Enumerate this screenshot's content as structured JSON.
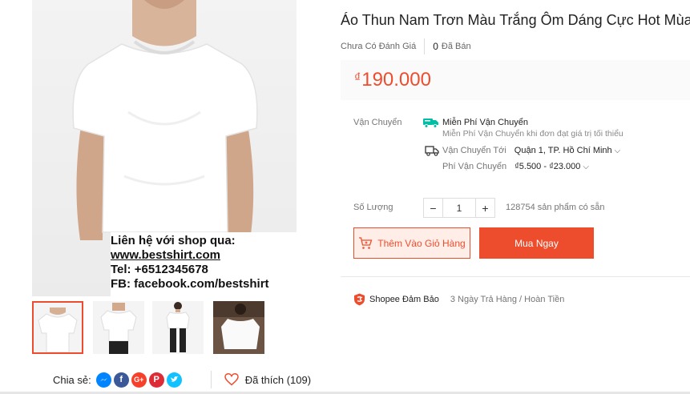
{
  "product": {
    "title": "Áo Thun Nam Trơn Màu Trắng Ôm Dáng Cực Hot Mùa Hè",
    "rating_text": "Chưa Có Đánh Giá",
    "sold_count": "0",
    "sold_label": "Đã Bán",
    "price_currency": "₫",
    "price": "190.000"
  },
  "image_overlay": {
    "line1": "Liên hệ với shop qua:",
    "line2": "www.bestshirt.com",
    "line3": "Tel: +6512345678",
    "line4": "FB: facebook.com/bestshirt"
  },
  "shipping": {
    "label": "Vận Chuyển",
    "free_title": "Miễn Phí Vận Chuyển",
    "free_desc": "Miễn Phí Vận Chuyển khi đơn đạt giá trị tối thiểu",
    "to_label": "Vận Chuyển Tới",
    "to_value": "Quận 1, TP. Hồ Chí Minh",
    "fee_label": "Phí Vận Chuyển",
    "fee_value": "₫5.500 - ₫23.000",
    "icons": [
      "free-shipping-truck-icon",
      "truck-icon"
    ]
  },
  "quantity": {
    "label": "Số Lượng",
    "minus": "−",
    "value": "1",
    "plus": "+",
    "stock": "128754 sản phẩm có sẵn"
  },
  "actions": {
    "add_to_cart": "Thêm Vào Giỏ Hàng",
    "buy_now": "Mua Ngay"
  },
  "guarantee": {
    "title": "Shopee Đảm Bảo",
    "desc": "3 Ngày Trả Hàng / Hoàn Tiền"
  },
  "share": {
    "label": "Chia sẻ:",
    "networks": [
      {
        "name": "messenger-icon",
        "color": "#0084ff"
      },
      {
        "name": "facebook-icon",
        "color": "#3b5999"
      },
      {
        "name": "google-plus-icon",
        "color": "#f73f2a"
      },
      {
        "name": "pinterest-icon",
        "color": "#de2c36"
      },
      {
        "name": "twitter-icon",
        "color": "#10c2ff"
      }
    ],
    "liked_label": "Đã thích (109)"
  },
  "colors": {
    "accent": "#ee4d2d",
    "accent_light": "#ffeee8",
    "teal": "#00bfa5"
  }
}
